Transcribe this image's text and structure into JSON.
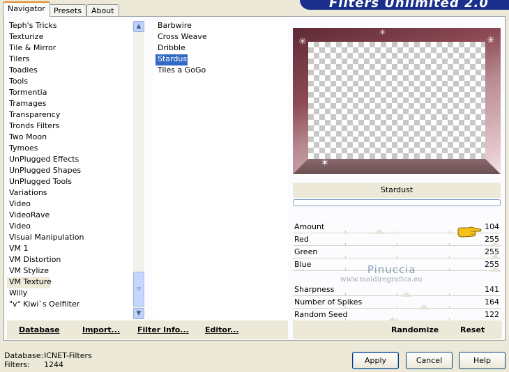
{
  "tabs": [
    "Navigator",
    "Presets",
    "About"
  ],
  "banner": {
    "title": "Filters Unlimited 2.0"
  },
  "categories": [
    "Teph's Tricks",
    "Texturize",
    "Tile & Mirror",
    "Tilers",
    "Toadies",
    "Tools",
    "Tormentia",
    "Tramages",
    "Transparency",
    "Tronds Filters",
    "Two Moon",
    "Tymoes",
    "UnPlugged Effects",
    "UnPlugged Shapes",
    "UnPlugged Tools",
    "Variations",
    "Video",
    "VideoRave",
    "Video",
    "Visual Manipulation",
    "VM 1",
    "VM Distortion",
    "VM Stylize",
    "VM Texture",
    "Willy",
    "\"v\" Kiwi`s Oelfilter"
  ],
  "selected_category": "VM Texture",
  "filters": [
    "Barbwire",
    "Cross Weave",
    "Dribble",
    "Stardust",
    "Tiles a GoGo"
  ],
  "selected_filter": "Stardust",
  "left_buttons": {
    "database": "Database",
    "import": "Import...",
    "filter_info": "Filter Info...",
    "editor": "Editor..."
  },
  "preview": {
    "filter_name": "Stardust"
  },
  "params": [
    {
      "name": "Amount",
      "value": "104",
      "level": 0.41
    },
    {
      "name": "Red",
      "value": "255",
      "level": 1.0
    },
    {
      "name": "Green",
      "value": "255",
      "level": 1.0
    },
    {
      "name": "Blue",
      "value": "255",
      "level": 1.0
    },
    {
      "name": "",
      "value": "",
      "level": null
    },
    {
      "name": "Sharpness",
      "value": "141",
      "level": 0.55
    },
    {
      "name": "Number of Spikes",
      "value": "164",
      "level": 0.64
    },
    {
      "name": "Random Seed",
      "value": "122",
      "level": 0.48
    }
  ],
  "right_buttons": {
    "randomize": "Randomize",
    "reset": "Reset"
  },
  "watermark": {
    "line1": "Pinuccia",
    "line2": "www.maidiregrafica.eu"
  },
  "status": {
    "database_label": "Database:",
    "database_value": "ICNET-Filters",
    "filters_label": "Filters:",
    "filters_value": "1244"
  },
  "dialog_buttons": {
    "apply": "Apply",
    "cancel": "Cancel",
    "help": "Help"
  },
  "colors": {
    "selection": "#316ac5",
    "banner": "#1a2f8c",
    "accent_tab": "#e68b2c"
  }
}
